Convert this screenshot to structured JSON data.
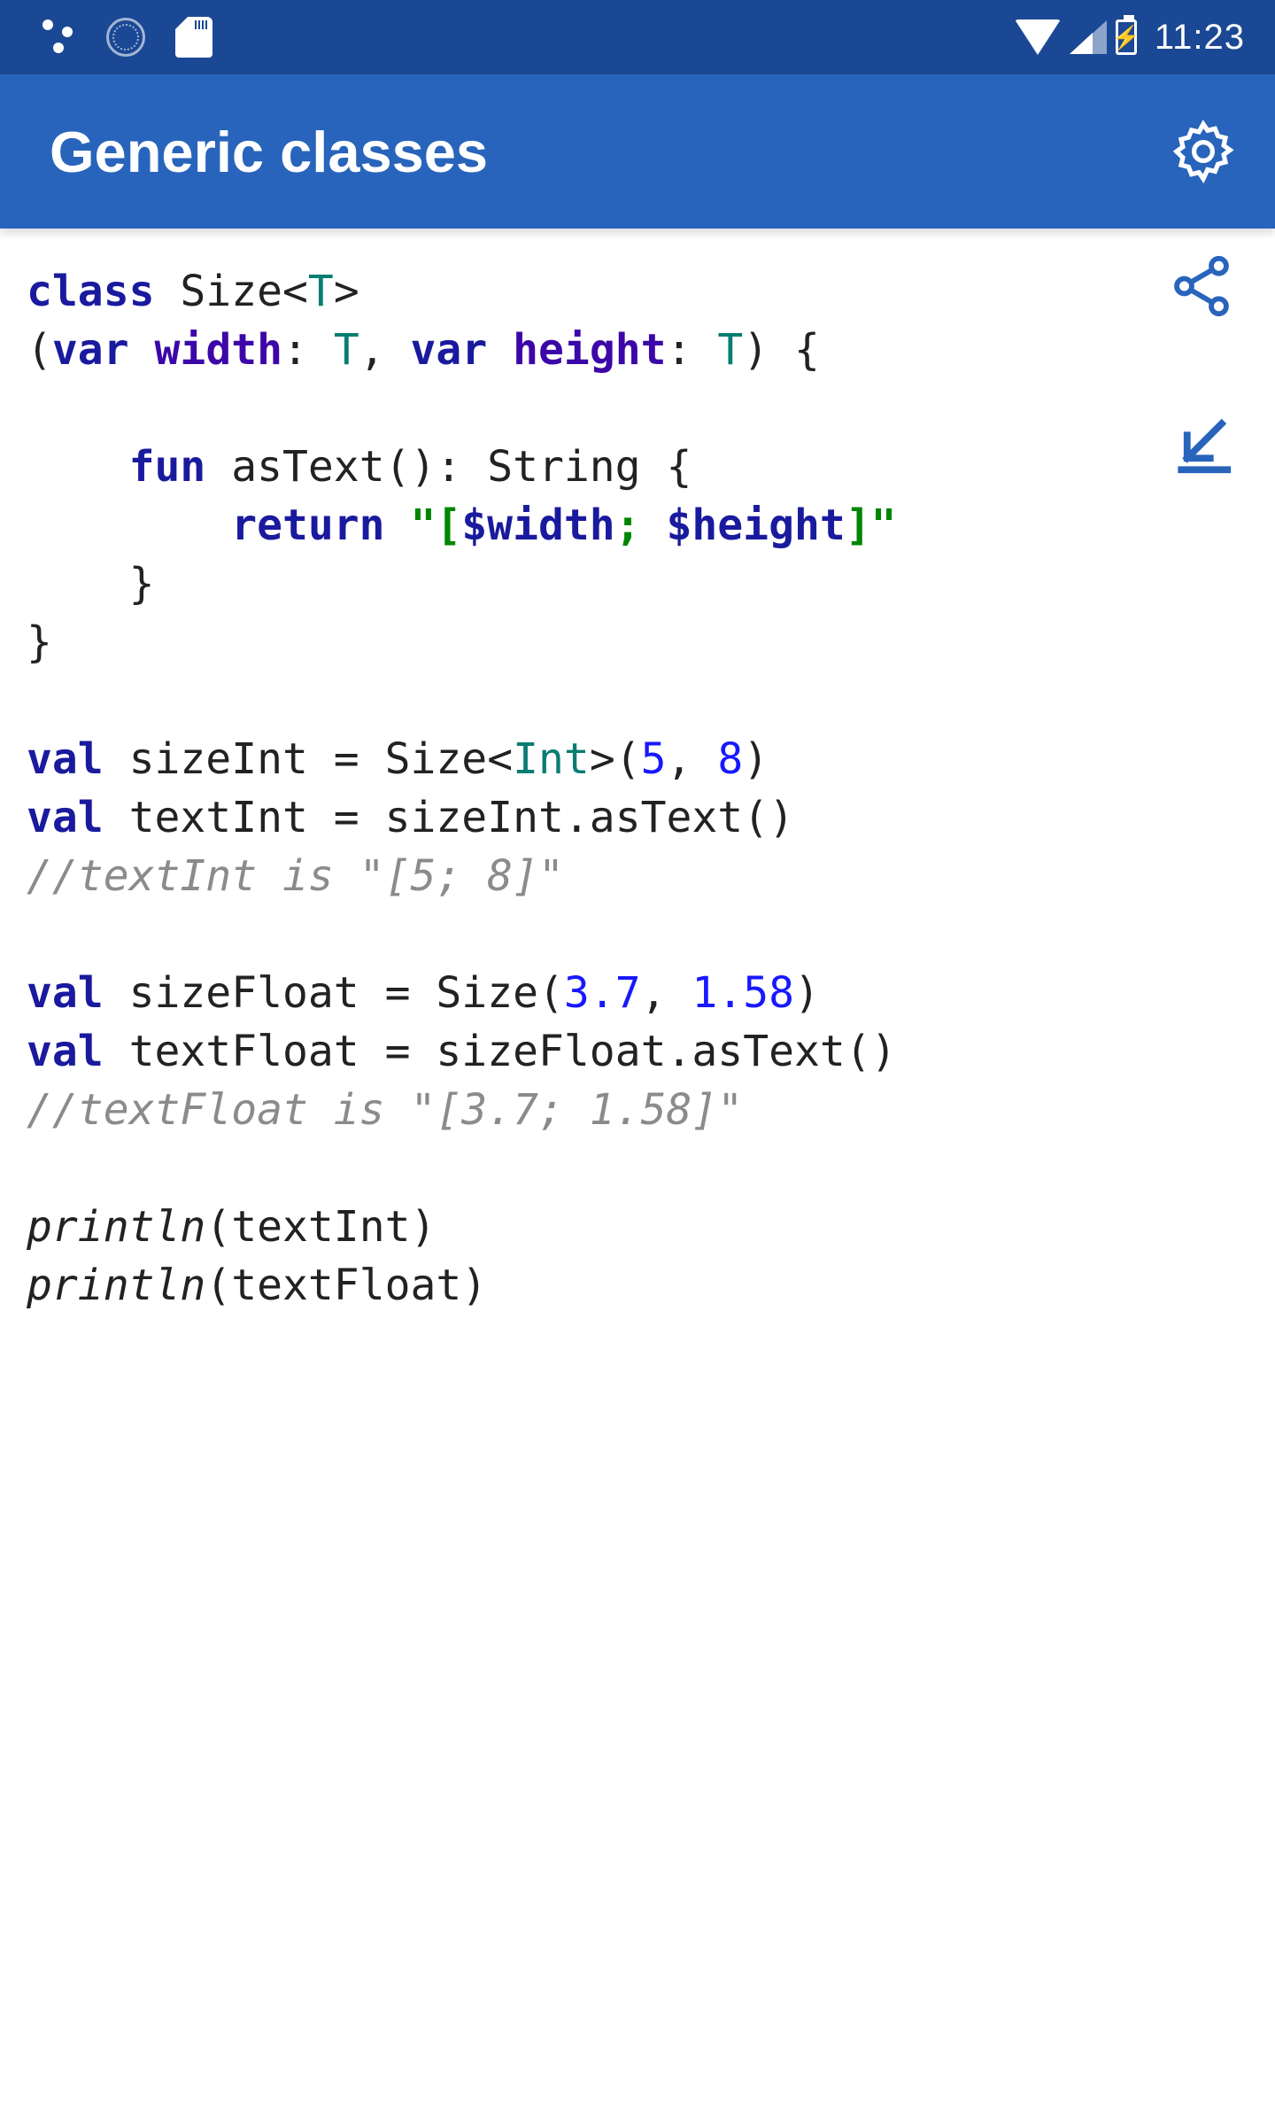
{
  "status": {
    "time": "11:23"
  },
  "appbar": {
    "title": "Generic classes"
  },
  "code": {
    "kw_class": "class",
    "classname": "Size",
    "type_T": "T",
    "kw_var1": "var",
    "prop_width": "width",
    "kw_var2": "var",
    "prop_height": "height",
    "kw_fun": "fun",
    "fun_name": "asText",
    "ret_type": "String",
    "kw_return": "return",
    "str_open": "\"[",
    "tpl_w": "$width",
    "str_sep": "; ",
    "tpl_h": "$height",
    "str_close": "]\"",
    "kw_val1": "val",
    "v1": "sizeInt",
    "call1a": "Size",
    "type_Int": "Int",
    "n5": "5",
    "n8": "8",
    "kw_val2": "val",
    "v2": "textInt",
    "call2": "sizeInt.asText()",
    "cmt1": "//textInt is \"[5; 8]\"",
    "kw_val3": "val",
    "v3": "sizeFloat",
    "call3a": "Size",
    "n37": "3.7",
    "n158": "1.58",
    "kw_val4": "val",
    "v4": "textFloat",
    "call4": "sizeFloat.asText()",
    "cmt2": "//textFloat is \"[3.7; 1.58]\"",
    "println1": "println",
    "arg1": "(textInt)",
    "println2": "println",
    "arg2": "(textFloat)"
  }
}
